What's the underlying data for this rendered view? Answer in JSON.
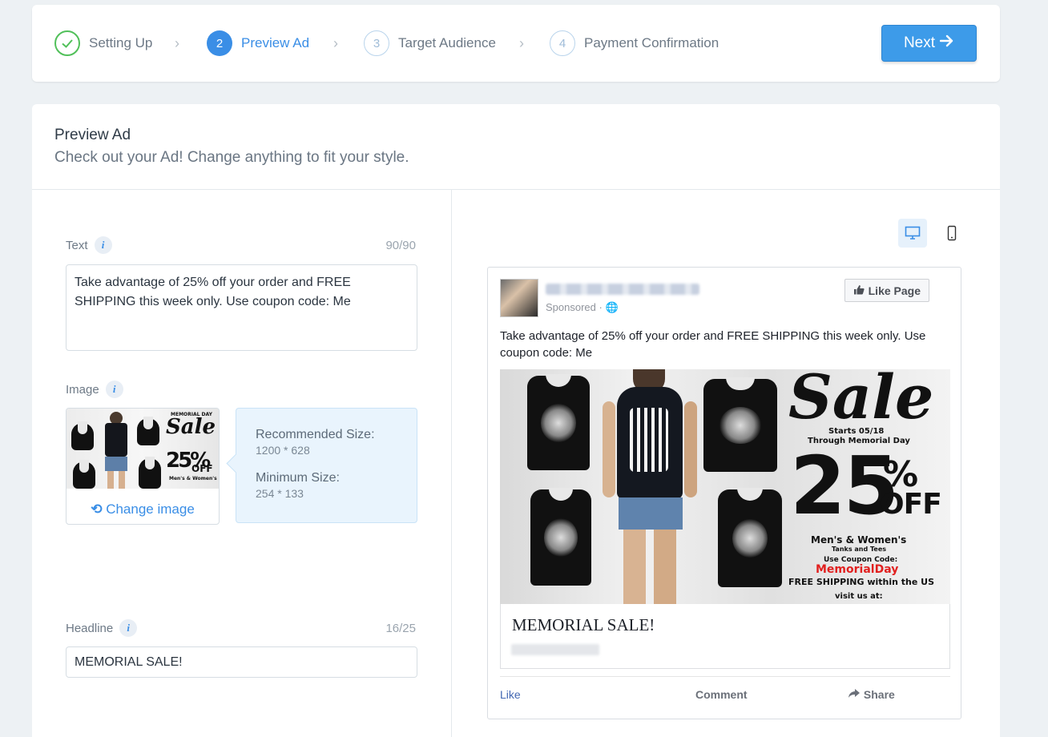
{
  "steps": [
    {
      "number": "",
      "label": "Setting Up",
      "state": "done"
    },
    {
      "number": "2",
      "label": "Preview Ad",
      "state": "active"
    },
    {
      "number": "3",
      "label": "Target Audience",
      "state": "todo"
    },
    {
      "number": "4",
      "label": "Payment Confirmation",
      "state": "todo"
    }
  ],
  "next_button": {
    "label": "Next",
    "icon": "arrow-right-icon"
  },
  "section": {
    "title": "Preview Ad",
    "subtitle": "Check out your Ad! Change anything to fit your style."
  },
  "text_field": {
    "label": "Text",
    "counter": "90/90",
    "value": "Take advantage of 25% off your order and FREE SHIPPING this week only. Use coupon code: Me"
  },
  "image_field": {
    "label": "Image",
    "change_label": "Change image",
    "recommended_label": "Recommended Size:",
    "recommended_value": "1200 * 628",
    "minimum_label": "Minimum Size:",
    "minimum_value": "254 * 133"
  },
  "headline_field": {
    "label": "Headline",
    "counter": "16/25",
    "value": "MEMORIAL SALE!"
  },
  "preview": {
    "sponsored": "Sponsored · ",
    "like_page": "Like Page",
    "text": "Take advantage of 25% off your order and FREE SHIPPING this week only. Use coupon code: Me",
    "headline": "MEMORIAL SALE!",
    "actions": {
      "like": "Like",
      "comment": "Comment",
      "share": "Share"
    },
    "image": {
      "sale": "Sale",
      "dates": "Starts 05/18",
      "dates2": "Through Memorial Day",
      "pct": "25",
      "pct_sign": "%",
      "off": "OFF",
      "mens": "Men's & Women's",
      "tanks": "Tanks and Tees",
      "use_code": "Use Coupon Code:",
      "code": "MemorialDay",
      "shipping": "FREE SHIPPING within the US",
      "visit": "visit us at:",
      "thumb_top": "MEMORIAL DAY",
      "thumb_sale": "Sale",
      "thumb_pct": "25%",
      "thumb_off": "OFF",
      "thumb_mens": "Men's & Women's"
    }
  },
  "colors": {
    "accent": "#3a8ee6",
    "success": "#51c05a",
    "facebook_link": "#4267b2",
    "coupon_red": "#e1201f"
  }
}
